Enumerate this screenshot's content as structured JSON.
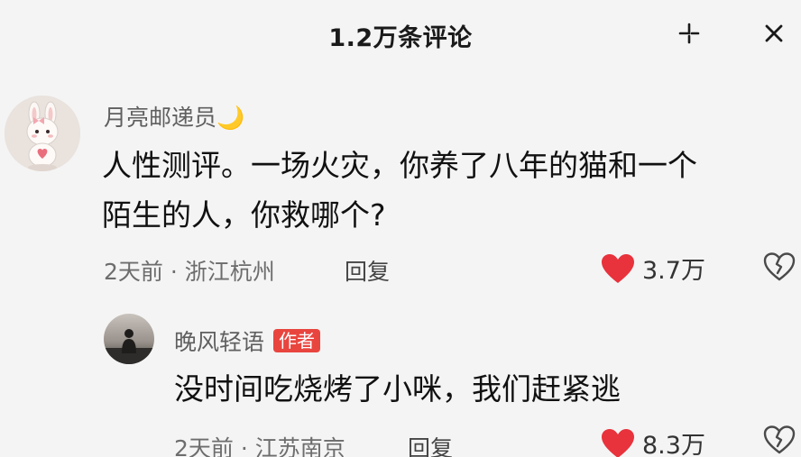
{
  "header": {
    "title": "1.2万条评论"
  },
  "comments": [
    {
      "username": "月亮邮递员",
      "user_emoji": "🌙",
      "text_line1": "人性测评。一场火灾，你养了八年的猫和一个",
      "text_line2": "陌生的人，你救哪个?",
      "time": "2天前",
      "separator": "·",
      "location": "浙江杭州",
      "reply_label": "回复",
      "likes": "3.7万"
    }
  ],
  "replies": [
    {
      "username": "晚风轻语",
      "badge": "作者",
      "text": "没时间吃烧烤了小咪，我们赶紧逃",
      "time": "2天前",
      "separator": "·",
      "location": "江苏南京",
      "reply_label": "回复",
      "likes": "8.3万"
    }
  ],
  "colors": {
    "like_red": "#e8323c",
    "badge_red": "#e9453f",
    "background": "#f4f4f4"
  }
}
